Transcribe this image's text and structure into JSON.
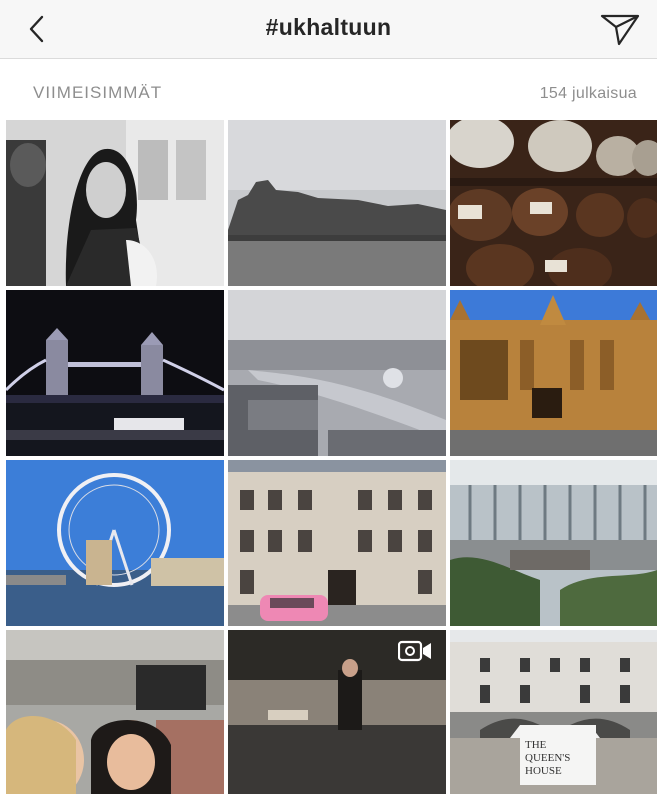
{
  "header": {
    "title": "#ukhaltuun",
    "back_icon": "chevron-left-icon",
    "share_icon": "paper-plane-icon"
  },
  "section": {
    "label": "VIIMEISIMMÄT",
    "count": "154 julkaisua"
  },
  "posts": [
    {
      "subject": "bw-portrait"
    },
    {
      "subject": "castle"
    },
    {
      "subject": "whisky-barrels"
    },
    {
      "subject": "tower-bridge-night"
    },
    {
      "subject": "thames-aerial"
    },
    {
      "subject": "westminster"
    },
    {
      "subject": "london-eye"
    },
    {
      "subject": "pink-car-building"
    },
    {
      "subject": "sky-garden"
    },
    {
      "subject": "palace-selfie"
    },
    {
      "subject": "bagpiper",
      "badge": "video-camera-icon"
    },
    {
      "subject": "queens-house",
      "sign": [
        "THE",
        "QUEEN'S",
        "HOUSE"
      ]
    }
  ],
  "colors": {
    "header_bg": "#f7f7f7",
    "label_gray": "#8e8e8e",
    "text_dark": "#262626"
  }
}
